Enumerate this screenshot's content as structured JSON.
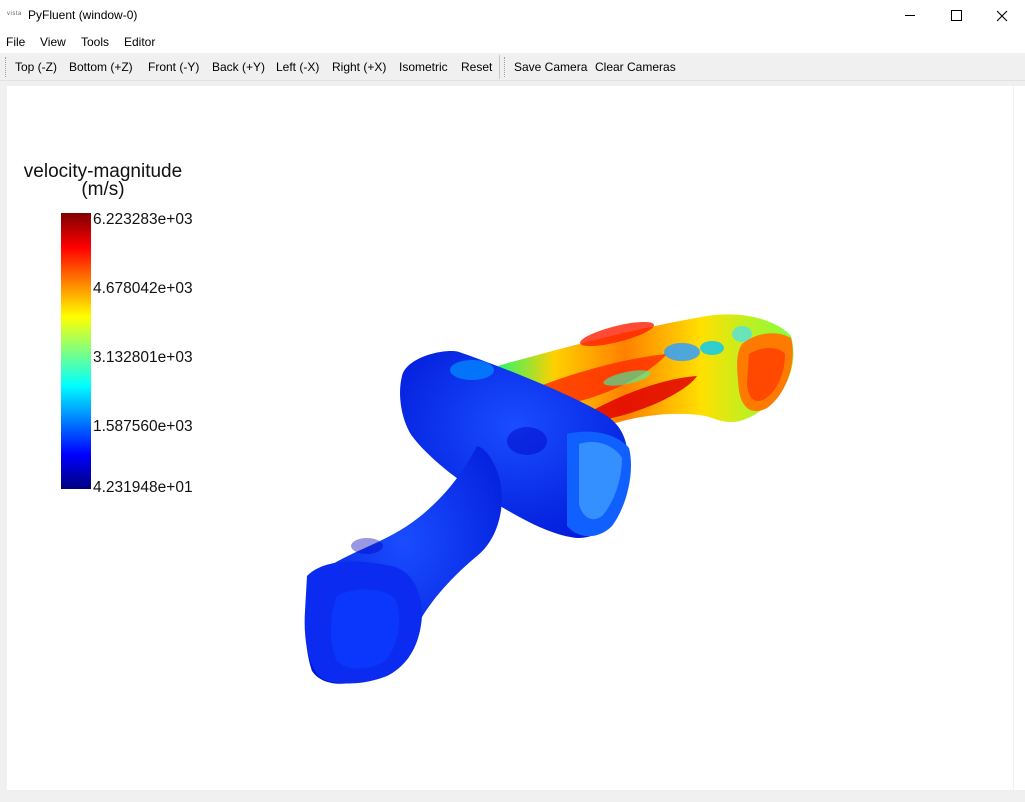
{
  "window": {
    "title": "PyFluent (window-0)",
    "logo": "vista"
  },
  "menu": [
    "File",
    "View",
    "Tools",
    "Editor"
  ],
  "toolbar": {
    "views": [
      "Top (-Z)",
      "Bottom (+Z)",
      "Front (-Y)",
      "Back (+Y)",
      "Left (-X)",
      "Right (+X)",
      "Isometric",
      "Reset"
    ],
    "camera": [
      "Save Camera",
      "Clear Cameras"
    ]
  },
  "legend": {
    "title_line1": "velocity-magnitude",
    "title_line2": "(m/s)",
    "ticks": [
      "6.223283e+03",
      "4.678042e+03",
      "3.132801e+03",
      "1.587560e+03",
      "4.231948e+01"
    ],
    "colormap": [
      "#7f0000",
      "#ff0000",
      "#ff8000",
      "#ffff00",
      "#80ff80",
      "#00ffff",
      "#0080ff",
      "#0000ff",
      "#00007f"
    ]
  },
  "icons": {
    "minimize": "minimize-icon",
    "maximize": "maximize-icon",
    "close": "close-icon"
  }
}
